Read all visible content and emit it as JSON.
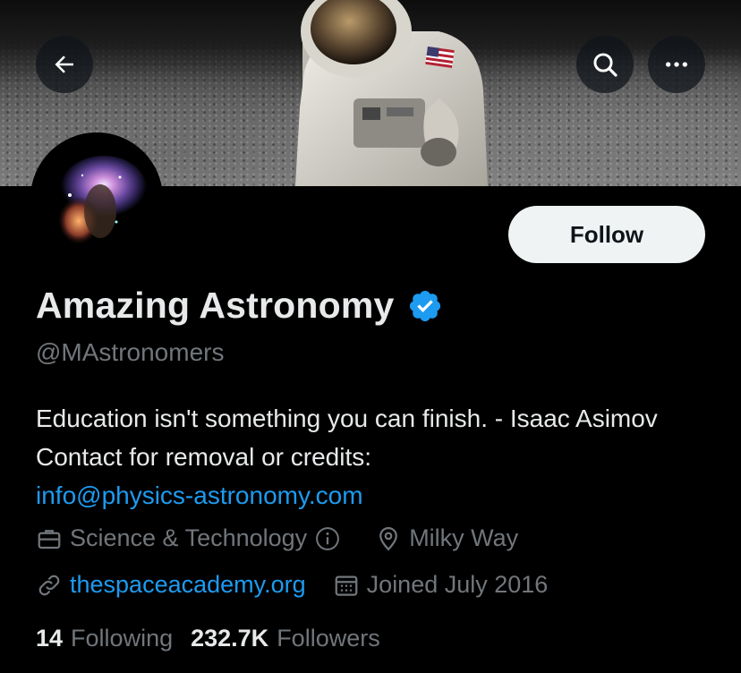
{
  "profile": {
    "name": "Amazing Astronomy",
    "handle": "@MAstronomers",
    "bio_text": "Education isn't something you can finish. - Isaac Asimov Contact for removal or credits:",
    "bio_link": "info@physics-astronomy.com",
    "category": "Science & Technology",
    "location": "Milky Way",
    "website": "thespaceacademy.org",
    "joined": "Joined July 2016",
    "following_count": "14",
    "following_label": "Following",
    "followers_count": "232.7K",
    "followers_label": "Followers"
  },
  "actions": {
    "follow_label": "Follow"
  },
  "icons": {
    "back": "arrow-left-icon",
    "search": "search-icon",
    "more": "more-icon",
    "verified": "verified-badge-icon",
    "category": "briefcase-icon",
    "info": "info-icon",
    "location": "location-pin-icon",
    "link": "link-icon",
    "calendar": "calendar-icon"
  },
  "colors": {
    "background": "#000000",
    "primary_text": "#e7e9ea",
    "secondary_text": "#71767b",
    "link": "#1d9bf0",
    "follow_button_bg": "#eff3f4",
    "verified": "#1d9bf0"
  }
}
